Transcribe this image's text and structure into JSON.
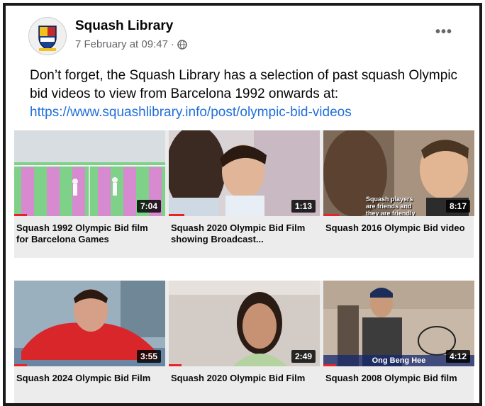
{
  "post": {
    "author": "Squash Library",
    "timestamp": "7 February at 09:47",
    "separator": "·",
    "privacy_icon": "globe-icon",
    "more_options": "•••",
    "message": "Don’t forget, the Squash Library has a selection of past squash Olympic bid videos to view from Barcelona 1992 onwards  at:",
    "link": "https://www.squashlibrary.info/post/olympic-bid-videos"
  },
  "videos": [
    {
      "title": "Squash 1992 Olympic Bid film for Barcelona Games",
      "duration": "7:04"
    },
    {
      "title": "Squash 2020 Olympic Bid Film showing Broadcast...",
      "duration": "1:13"
    },
    {
      "title": "Squash 2016 Olympic Bid video",
      "duration": "8:17",
      "caption": "Squash players are friends and they are friendly"
    },
    {
      "title": "Squash 2024 Olympic Bid Film",
      "duration": "3:55"
    },
    {
      "title": "Squash 2020 Olympic Bid Film",
      "duration": "2:49"
    },
    {
      "title": "Squash 2008 Olympic Bid film",
      "duration": "4:12",
      "caption": "Ong Beng Hee"
    }
  ],
  "colors": {
    "link": "#216fdb",
    "progress": "#e3242b"
  }
}
